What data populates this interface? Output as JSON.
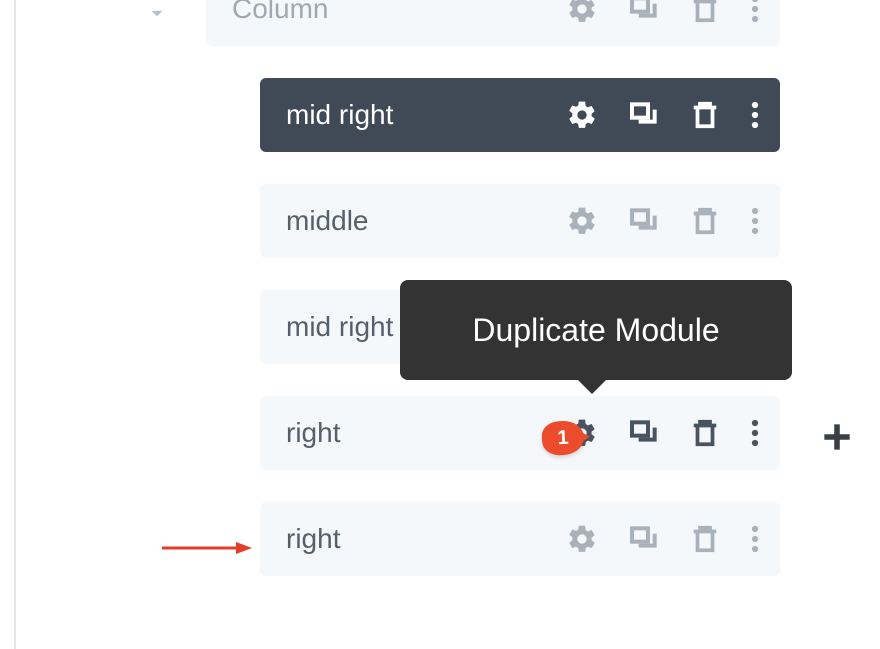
{
  "column": {
    "label": "Column"
  },
  "modules": [
    {
      "label": "mid right"
    },
    {
      "label": "middle"
    },
    {
      "label": "mid right"
    },
    {
      "label": "right"
    },
    {
      "label": "right"
    }
  ],
  "tooltip": {
    "text": "Duplicate Module"
  },
  "badge": {
    "number": "1"
  }
}
